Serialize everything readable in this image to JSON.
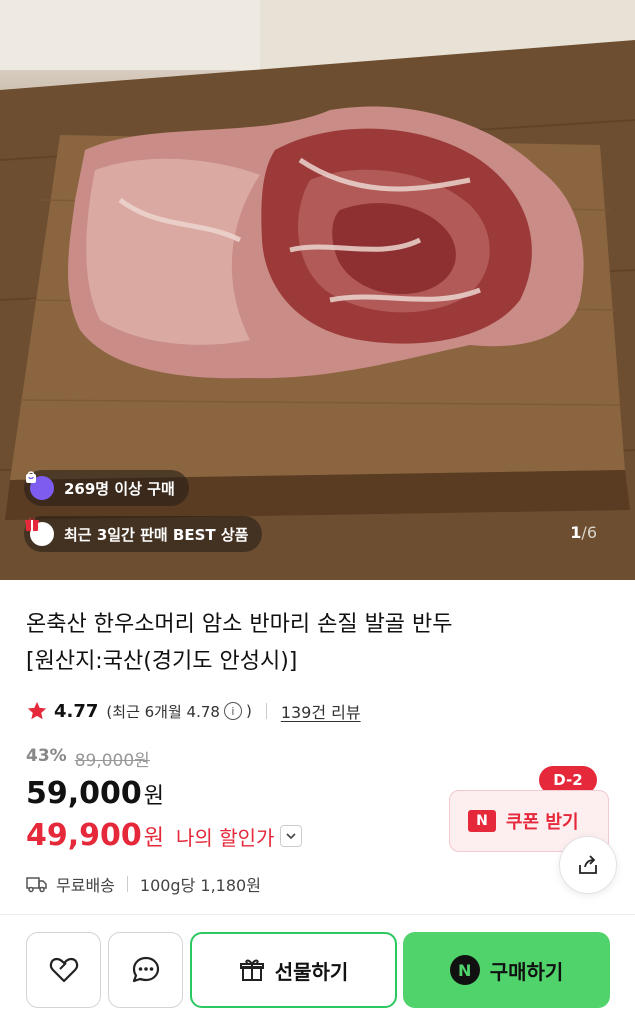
{
  "hero": {
    "badges": [
      {
        "text": "269명 이상 구매",
        "icon": "bag-icon"
      },
      {
        "text": "최근 3일간 판매 BEST 상품",
        "icon": "gift-icon"
      }
    ],
    "pager": {
      "current": "1",
      "total": "/6"
    }
  },
  "product": {
    "title_line1": "온축산 한우소머리 암소 반마리 손질 발골 반두",
    "title_line2": "[원산지:국산(경기도 안성시)]",
    "rating": "4.77",
    "rating_recent": "(최근 6개월 4.78",
    "rating_recent_close": ")",
    "info_symbol": "i",
    "review_count": "139건 리뷰",
    "discount_rate": "43%",
    "original_price": "89,000원",
    "price": "59,000",
    "price_unit": "원",
    "my_price": "49,900",
    "my_price_unit": "원",
    "my_price_label": "나의 할인가",
    "shipping": "무료배송",
    "unit_price": "100g당 1,180원"
  },
  "coupon": {
    "dday": "D-2",
    "n_mark": "N",
    "label": "쿠폰 받기"
  },
  "actions": {
    "gift_label": "선물하기",
    "buy_n_mark": "N",
    "buy_label": "구매하기"
  },
  "colors": {
    "accent_red": "#e5283a",
    "naver_green": "#4fd36a",
    "outline_green": "#2bc75f"
  }
}
